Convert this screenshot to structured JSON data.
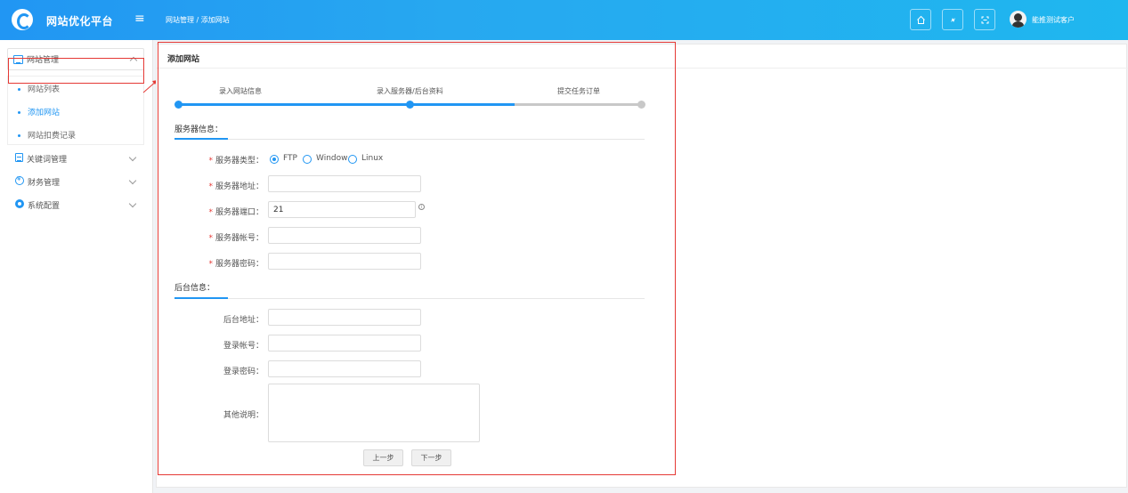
{
  "header": {
    "brand": "网站优化平台",
    "menu_icon": "≡",
    "breadcrumb": "网站管理 / 添加网站",
    "username": "能推测试客户",
    "icons": [
      "home-icon",
      "refresh-icon",
      "fullscreen-icon"
    ]
  },
  "sidebar": {
    "group": {
      "label": "网站管理",
      "icon": "list-icon"
    },
    "sub_items": [
      {
        "label": "网站列表"
      },
      {
        "label": "添加网站"
      },
      {
        "label": "网站扣费记录"
      }
    ],
    "rows": [
      {
        "label": "关键词管理",
        "icon": "doc-icon"
      },
      {
        "label": "财务管理",
        "icon": "money-icon"
      },
      {
        "label": "系统配置",
        "icon": "gear-icon"
      }
    ]
  },
  "card": {
    "title": "添加网站"
  },
  "steps": [
    {
      "label": "录入网站信息",
      "done": true
    },
    {
      "label": "录入服务器/后台资料",
      "done": true
    },
    {
      "label": "提交任务订单",
      "done": false
    }
  ],
  "server_section": {
    "title": "服务器信息：",
    "type_label": "服务器类型：",
    "type_options": [
      "FTP",
      "Window",
      "Linux"
    ],
    "type_selected": "FTP",
    "address_label": "服务器地址：",
    "address_value": "",
    "port_label": "服务器端口：",
    "port_value": "21",
    "account_label": "服务器帐号：",
    "account_value": "",
    "password_label": "服务器密码：",
    "password_value": ""
  },
  "backend_section": {
    "title": "后台信息：",
    "address_label": "后台地址：",
    "address_value": "",
    "login_label": "登录帐号：",
    "login_value": "",
    "password_label": "登录密码：",
    "password_value": "",
    "notes_label": "其他说明：",
    "notes_value": ""
  },
  "buttons": {
    "prev": "上一步",
    "next": "下一步"
  },
  "colors": {
    "accent": "#2196f3",
    "annotation": "#e53935",
    "inactive_step": "#c8c8c8"
  }
}
